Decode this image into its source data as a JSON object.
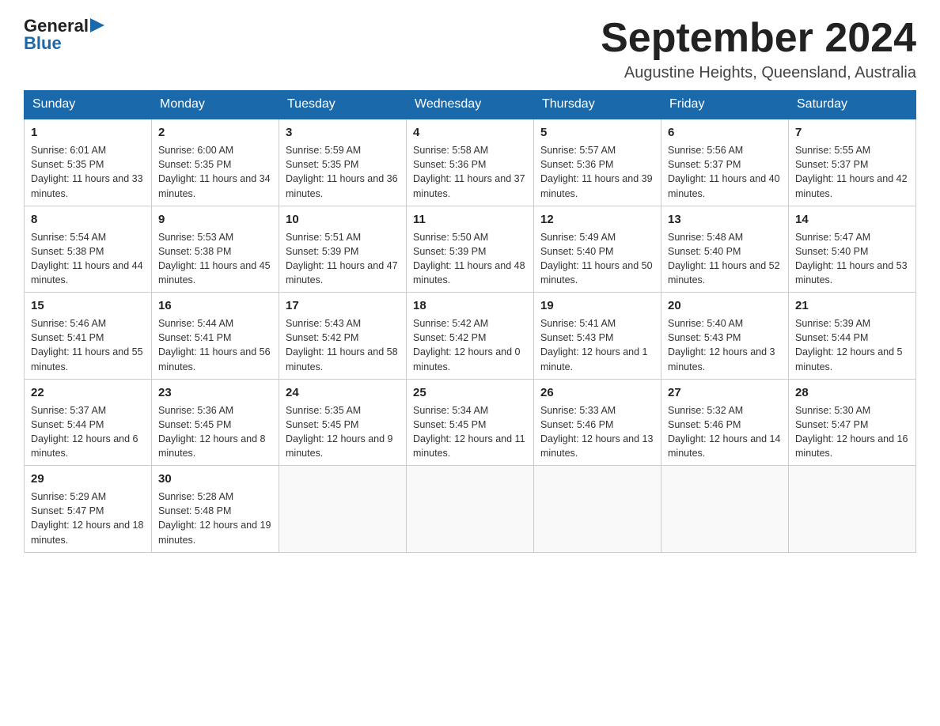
{
  "header": {
    "logo_general": "General",
    "logo_blue": "Blue",
    "month_title": "September 2024",
    "location": "Augustine Heights, Queensland, Australia"
  },
  "days_of_week": [
    "Sunday",
    "Monday",
    "Tuesday",
    "Wednesday",
    "Thursday",
    "Friday",
    "Saturday"
  ],
  "weeks": [
    [
      {
        "day": "1",
        "sunrise": "6:01 AM",
        "sunset": "5:35 PM",
        "daylight": "11 hours and 33 minutes."
      },
      {
        "day": "2",
        "sunrise": "6:00 AM",
        "sunset": "5:35 PM",
        "daylight": "11 hours and 34 minutes."
      },
      {
        "day": "3",
        "sunrise": "5:59 AM",
        "sunset": "5:35 PM",
        "daylight": "11 hours and 36 minutes."
      },
      {
        "day": "4",
        "sunrise": "5:58 AM",
        "sunset": "5:36 PM",
        "daylight": "11 hours and 37 minutes."
      },
      {
        "day": "5",
        "sunrise": "5:57 AM",
        "sunset": "5:36 PM",
        "daylight": "11 hours and 39 minutes."
      },
      {
        "day": "6",
        "sunrise": "5:56 AM",
        "sunset": "5:37 PM",
        "daylight": "11 hours and 40 minutes."
      },
      {
        "day": "7",
        "sunrise": "5:55 AM",
        "sunset": "5:37 PM",
        "daylight": "11 hours and 42 minutes."
      }
    ],
    [
      {
        "day": "8",
        "sunrise": "5:54 AM",
        "sunset": "5:38 PM",
        "daylight": "11 hours and 44 minutes."
      },
      {
        "day": "9",
        "sunrise": "5:53 AM",
        "sunset": "5:38 PM",
        "daylight": "11 hours and 45 minutes."
      },
      {
        "day": "10",
        "sunrise": "5:51 AM",
        "sunset": "5:39 PM",
        "daylight": "11 hours and 47 minutes."
      },
      {
        "day": "11",
        "sunrise": "5:50 AM",
        "sunset": "5:39 PM",
        "daylight": "11 hours and 48 minutes."
      },
      {
        "day": "12",
        "sunrise": "5:49 AM",
        "sunset": "5:40 PM",
        "daylight": "11 hours and 50 minutes."
      },
      {
        "day": "13",
        "sunrise": "5:48 AM",
        "sunset": "5:40 PM",
        "daylight": "11 hours and 52 minutes."
      },
      {
        "day": "14",
        "sunrise": "5:47 AM",
        "sunset": "5:40 PM",
        "daylight": "11 hours and 53 minutes."
      }
    ],
    [
      {
        "day": "15",
        "sunrise": "5:46 AM",
        "sunset": "5:41 PM",
        "daylight": "11 hours and 55 minutes."
      },
      {
        "day": "16",
        "sunrise": "5:44 AM",
        "sunset": "5:41 PM",
        "daylight": "11 hours and 56 minutes."
      },
      {
        "day": "17",
        "sunrise": "5:43 AM",
        "sunset": "5:42 PM",
        "daylight": "11 hours and 58 minutes."
      },
      {
        "day": "18",
        "sunrise": "5:42 AM",
        "sunset": "5:42 PM",
        "daylight": "12 hours and 0 minutes."
      },
      {
        "day": "19",
        "sunrise": "5:41 AM",
        "sunset": "5:43 PM",
        "daylight": "12 hours and 1 minute."
      },
      {
        "day": "20",
        "sunrise": "5:40 AM",
        "sunset": "5:43 PM",
        "daylight": "12 hours and 3 minutes."
      },
      {
        "day": "21",
        "sunrise": "5:39 AM",
        "sunset": "5:44 PM",
        "daylight": "12 hours and 5 minutes."
      }
    ],
    [
      {
        "day": "22",
        "sunrise": "5:37 AM",
        "sunset": "5:44 PM",
        "daylight": "12 hours and 6 minutes."
      },
      {
        "day": "23",
        "sunrise": "5:36 AM",
        "sunset": "5:45 PM",
        "daylight": "12 hours and 8 minutes."
      },
      {
        "day": "24",
        "sunrise": "5:35 AM",
        "sunset": "5:45 PM",
        "daylight": "12 hours and 9 minutes."
      },
      {
        "day": "25",
        "sunrise": "5:34 AM",
        "sunset": "5:45 PM",
        "daylight": "12 hours and 11 minutes."
      },
      {
        "day": "26",
        "sunrise": "5:33 AM",
        "sunset": "5:46 PM",
        "daylight": "12 hours and 13 minutes."
      },
      {
        "day": "27",
        "sunrise": "5:32 AM",
        "sunset": "5:46 PM",
        "daylight": "12 hours and 14 minutes."
      },
      {
        "day": "28",
        "sunrise": "5:30 AM",
        "sunset": "5:47 PM",
        "daylight": "12 hours and 16 minutes."
      }
    ],
    [
      {
        "day": "29",
        "sunrise": "5:29 AM",
        "sunset": "5:47 PM",
        "daylight": "12 hours and 18 minutes."
      },
      {
        "day": "30",
        "sunrise": "5:28 AM",
        "sunset": "5:48 PM",
        "daylight": "12 hours and 19 minutes."
      },
      null,
      null,
      null,
      null,
      null
    ]
  ]
}
